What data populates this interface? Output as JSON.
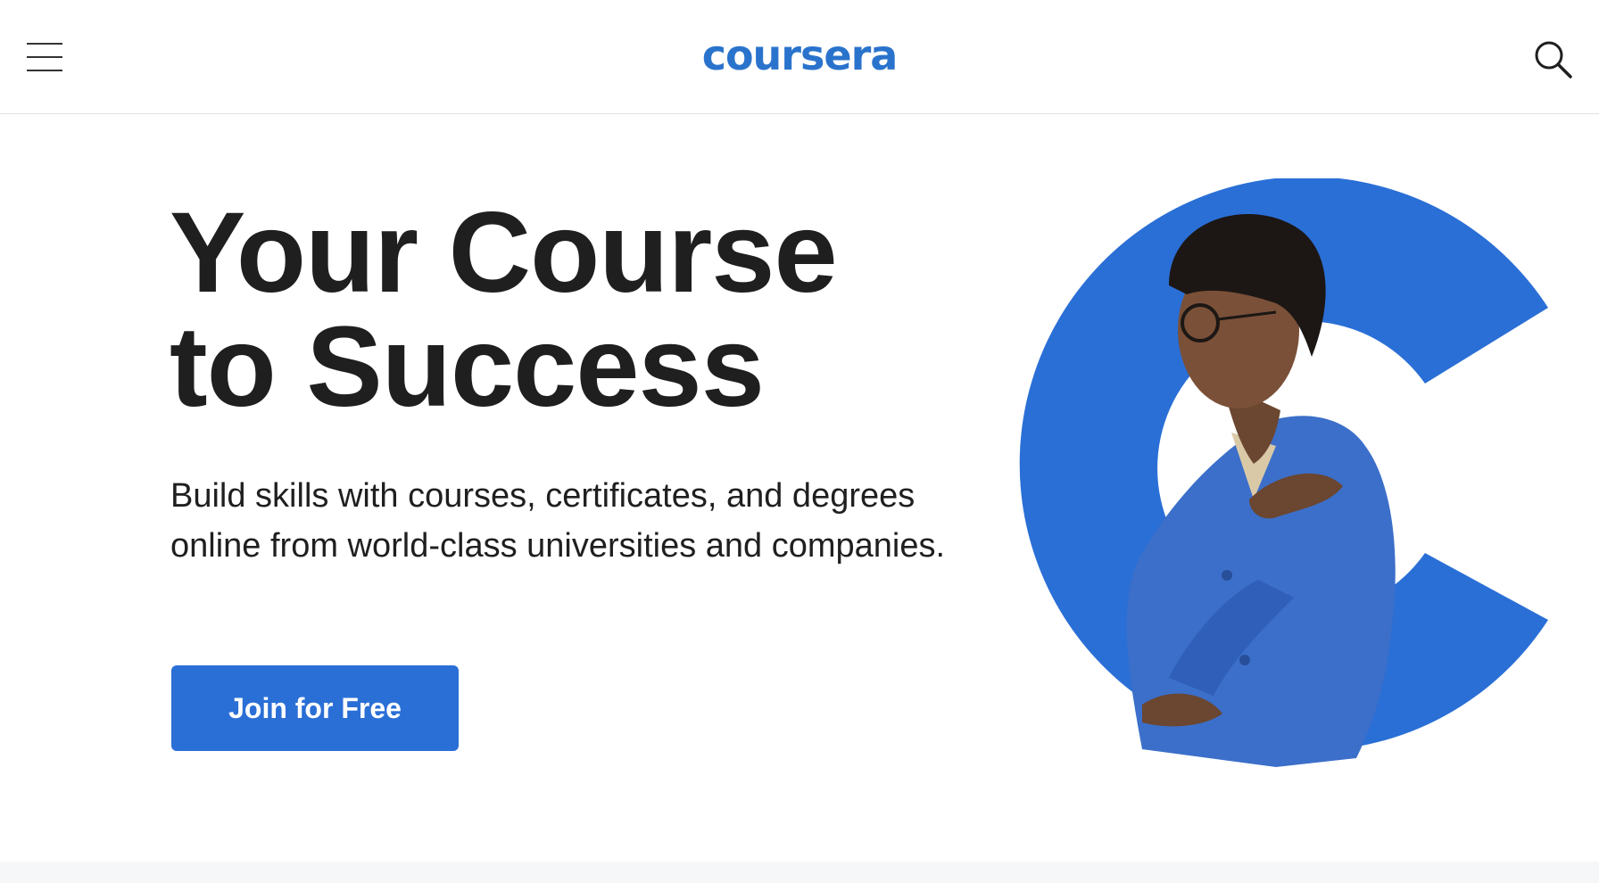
{
  "header": {
    "logo_text": "coursera",
    "menu_icon": "hamburger-menu-icon",
    "search_icon": "search-icon"
  },
  "hero": {
    "title_line1": "Your Course",
    "title_line2": "to Success",
    "subtitle": "Build skills with courses, certificates, and degrees online from world-class universities and companies.",
    "cta_label": "Join for Free",
    "image": "person-in-blue-jacket-over-coursera-c-graphic"
  },
  "colors": {
    "brand_blue": "#2a73cc",
    "cta_blue": "#2a6fd6",
    "text_dark": "#1f1f1f",
    "header_border": "#e1e1e1"
  }
}
